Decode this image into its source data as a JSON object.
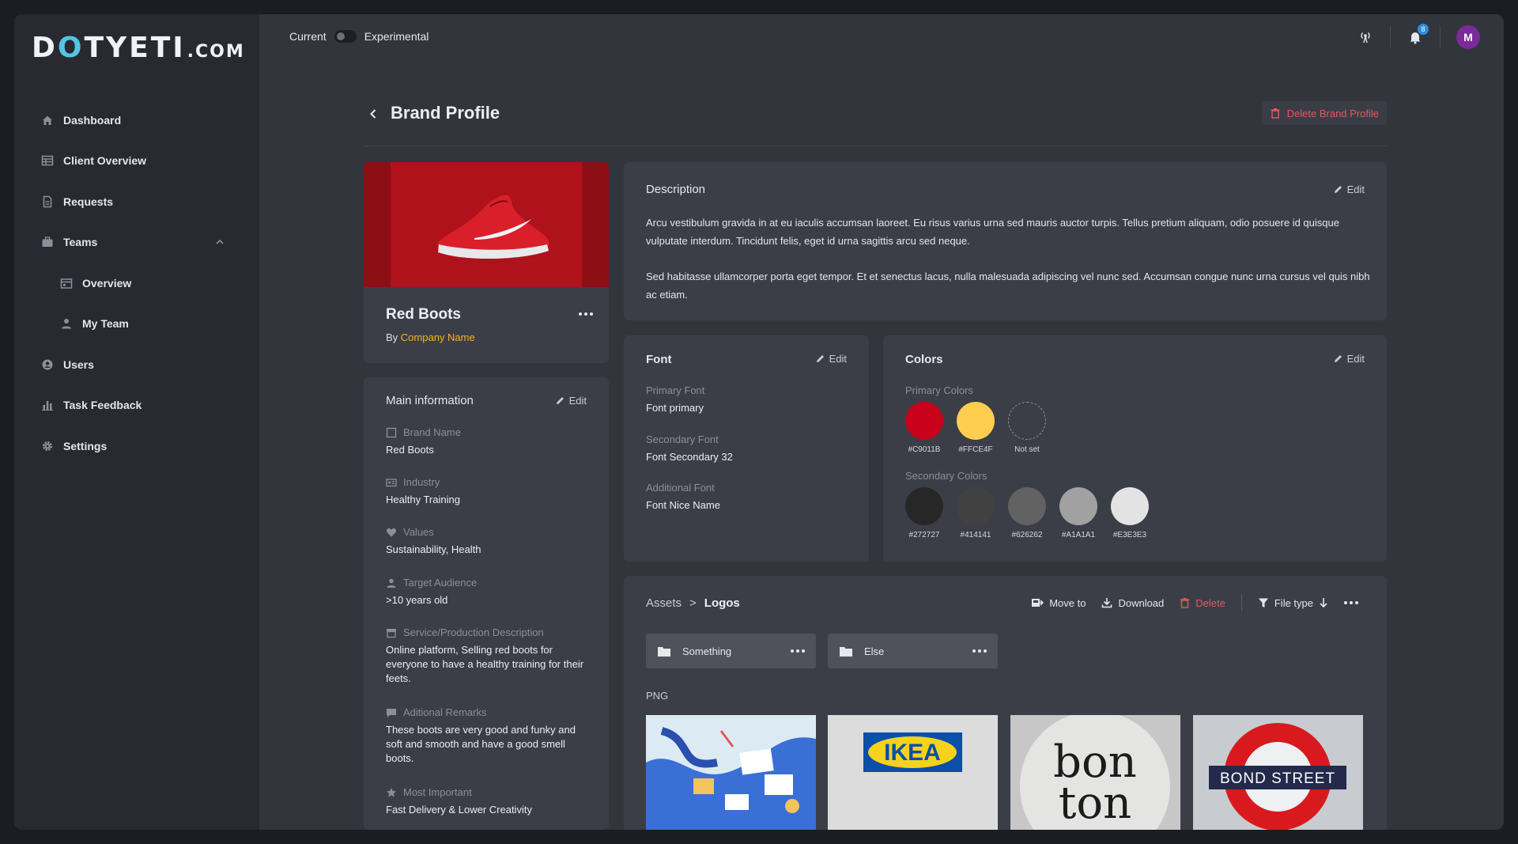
{
  "app": {
    "logo_main_pre": "D",
    "logo_main_dot": "O",
    "logo_main_post": "TYETI",
    "logo_suffix": ".COM"
  },
  "topbar": {
    "toggle_left": "Current",
    "toggle_right": "Experimental",
    "notification_count": "8",
    "avatar_initial": "M"
  },
  "sidebar": {
    "items": [
      {
        "label": "Dashboard",
        "icon": "home-icon"
      },
      {
        "label": "Client Overview",
        "icon": "table-icon"
      },
      {
        "label": "Requests",
        "icon": "document-icon"
      },
      {
        "label": "Teams",
        "icon": "briefcase-icon"
      },
      {
        "label": "Overview",
        "icon": "calendar-icon"
      },
      {
        "label": "My Team",
        "icon": "person-icon"
      },
      {
        "label": "Users",
        "icon": "user-circle-icon"
      },
      {
        "label": "Task Feedback",
        "icon": "bar-chart-icon"
      },
      {
        "label": "Settings",
        "icon": "gear-icon"
      }
    ]
  },
  "header": {
    "title": "Brand Profile",
    "delete_label": "Delete Brand Profile"
  },
  "product": {
    "name": "Red Boots",
    "by_prefix": "By",
    "company": "Company Name"
  },
  "main_info": {
    "title": "Main information",
    "edit_label": "Edit",
    "fields": [
      {
        "label": "Brand Name",
        "value": "Red Boots",
        "icon": "square-icon"
      },
      {
        "label": "Industry",
        "value": "Healthy Training",
        "icon": "id-card-icon"
      },
      {
        "label": "Values",
        "value": "Sustainability, Health",
        "icon": "heart-icon"
      },
      {
        "label": "Target Audience",
        "value": ">10 years old",
        "icon": "person-icon"
      },
      {
        "label": "Service/Production Description",
        "value": "Online platform, Selling red boots for everyone to have a healthy training for their feets.",
        "icon": "box-icon"
      },
      {
        "label": "Aditional Remarks",
        "value": "These boots are very good and funky and soft and smooth and have a good smell boots.",
        "icon": "comment-icon"
      },
      {
        "label": "Most Important",
        "value": "Fast Delivery & Lower Creativity",
        "icon": "star-icon"
      }
    ]
  },
  "description": {
    "title": "Description",
    "edit_label": "Edit",
    "paragraphs": [
      "Arcu vestibulum gravida in at eu iaculis accumsan laoreet. Eu risus varius urna sed mauris auctor turpis. Tellus pretium aliquam, odio posuere id quisque vulputate interdum. Tincidunt felis, eget id urna sagittis arcu sed neque.",
      "Sed habitasse ullamcorper porta eget tempor. Et et senectus lacus, nulla malesuada adipiscing vel nunc sed. Accumsan congue nunc urna cursus vel quis nibh ac etiam."
    ]
  },
  "font": {
    "title": "Font",
    "edit_label": "Edit",
    "fields": [
      {
        "label": "Primary Font",
        "value": "Font primary"
      },
      {
        "label": "Secondary Font",
        "value": "Font Secondary 32"
      },
      {
        "label": "Additional Font",
        "value": "Font Nice Name"
      }
    ]
  },
  "colors": {
    "title": "Colors",
    "edit_label": "Edit",
    "primary_label": "Primary Colors",
    "secondary_label": "Secondary Colors",
    "primary": [
      {
        "code": "#C9011B",
        "color": "#C9011B"
      },
      {
        "code": "#FFCE4F",
        "color": "#FFCE4F"
      },
      {
        "code": "Not set",
        "color": ""
      }
    ],
    "secondary": [
      {
        "code": "#272727",
        "color": "#272727"
      },
      {
        "code": "#414141",
        "color": "#414141"
      },
      {
        "code": "#626262",
        "color": "#626262"
      },
      {
        "code": "#A1A1A1",
        "color": "#A1A1A1"
      },
      {
        "code": "#E3E3E3",
        "color": "#E3E3E3"
      }
    ]
  },
  "assets": {
    "breadcrumb_root": "Assets",
    "breadcrumb_sep": ">",
    "breadcrumb_current": "Logos",
    "toolbar": {
      "move_to": "Move to",
      "download": "Download",
      "delete": "Delete",
      "file_type": "File type"
    },
    "folders": [
      {
        "name": "Something"
      },
      {
        "name": "Else"
      }
    ],
    "png_label": "PNG",
    "thumbnails": [
      {
        "alt": "illustration"
      },
      {
        "alt": "IKEA",
        "text": "IKEA"
      },
      {
        "alt": "bon ton",
        "text_top": "bon",
        "text_bottom": "ton"
      },
      {
        "alt": "BOND STREET",
        "text": "BOND STREET"
      }
    ]
  }
}
